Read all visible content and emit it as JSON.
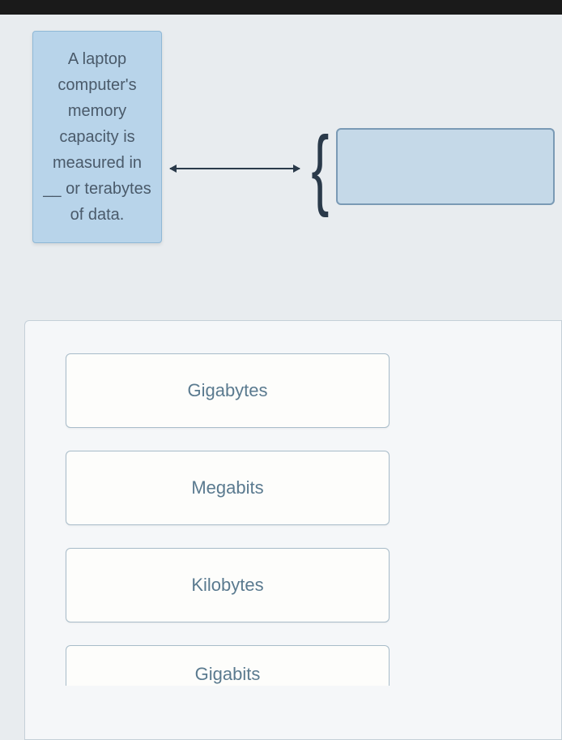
{
  "question": {
    "prompt": "A laptop computer's memory capacity is measured in __ or terabytes of data."
  },
  "options": [
    {
      "label": "Gigabytes"
    },
    {
      "label": "Megabits"
    },
    {
      "label": "Kilobytes"
    },
    {
      "label": "Gigabits"
    }
  ]
}
